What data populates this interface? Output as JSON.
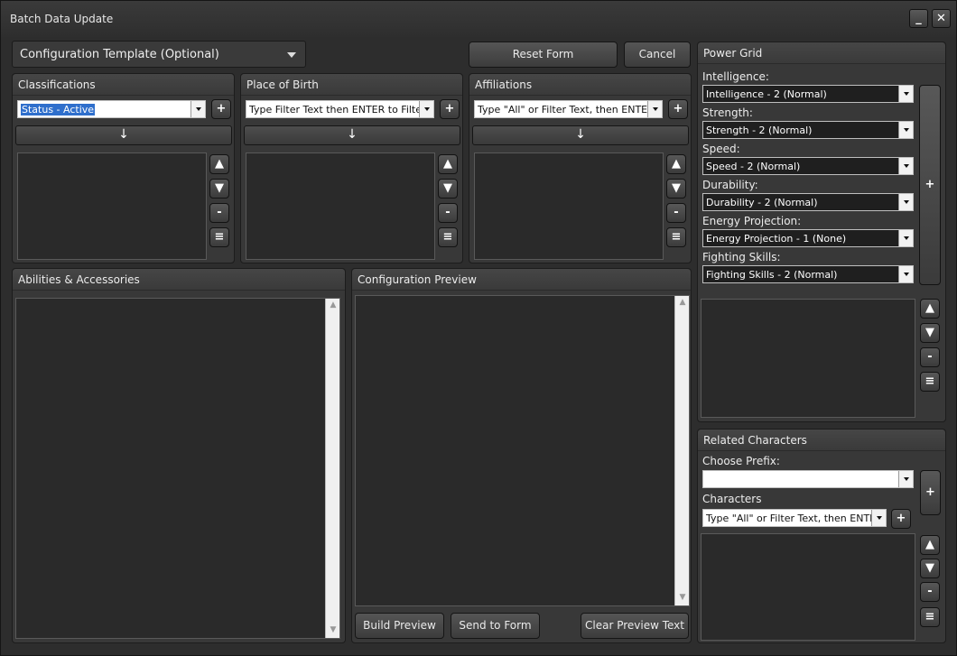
{
  "window": {
    "title": "Batch Data Update",
    "minimize": "_",
    "close": "✕"
  },
  "top": {
    "template_combo": "Configuration Template (Optional)",
    "reset_button": "Reset Form",
    "cancel_button": "Cancel"
  },
  "classifications": {
    "title": "Classifications",
    "combo_value": "Status - Active",
    "add": "+",
    "transfer": "↓",
    "up": "▲",
    "down": "▼",
    "remove": "-",
    "sort": "≡"
  },
  "place_of_birth": {
    "title": "Place of Birth",
    "combo_value": "Type Filter Text then ENTER to Filter",
    "add": "+",
    "transfer": "↓",
    "up": "▲",
    "down": "▼",
    "remove": "-",
    "sort": "≡"
  },
  "affiliations": {
    "title": "Affiliations",
    "combo_value": "Type \"All\" or Filter Text, then ENTER",
    "add": "+",
    "transfer": "↓",
    "up": "▲",
    "down": "▼",
    "remove": "-",
    "sort": "≡"
  },
  "abilities": {
    "title": "Abilities & Accessories"
  },
  "preview": {
    "title": "Configuration Preview",
    "build_button": "Build Preview",
    "send_button": "Send to Form",
    "clear_button": "Clear Preview Text"
  },
  "power_grid": {
    "title": "Power Grid",
    "add": "+",
    "up": "▲",
    "down": "▼",
    "remove": "-",
    "sort": "≡",
    "fields": [
      {
        "label": "Intelligence:",
        "value": "Intelligence - 2 (Normal)"
      },
      {
        "label": "Strength:",
        "value": "Strength - 2 (Normal)"
      },
      {
        "label": "Speed:",
        "value": "Speed - 2 (Normal)"
      },
      {
        "label": "Durability:",
        "value": "Durability - 2 (Normal)"
      },
      {
        "label": "Energy Projection:",
        "value": "Energy Projection - 1 (None)"
      },
      {
        "label": "Fighting Skills:",
        "value": "Fighting Skills - 2 (Normal)"
      }
    ]
  },
  "related": {
    "title": "Related Characters",
    "prefix_label": "Choose Prefix:",
    "prefix_value": "",
    "characters_label": "Characters",
    "characters_value": "Type \"All\" or Filter Text, then ENTER",
    "add_large": "+",
    "add_small": "+",
    "up": "▲",
    "down": "▼",
    "remove": "-",
    "sort": "≡"
  },
  "scroll": {
    "up": "▲",
    "down": "▼"
  }
}
